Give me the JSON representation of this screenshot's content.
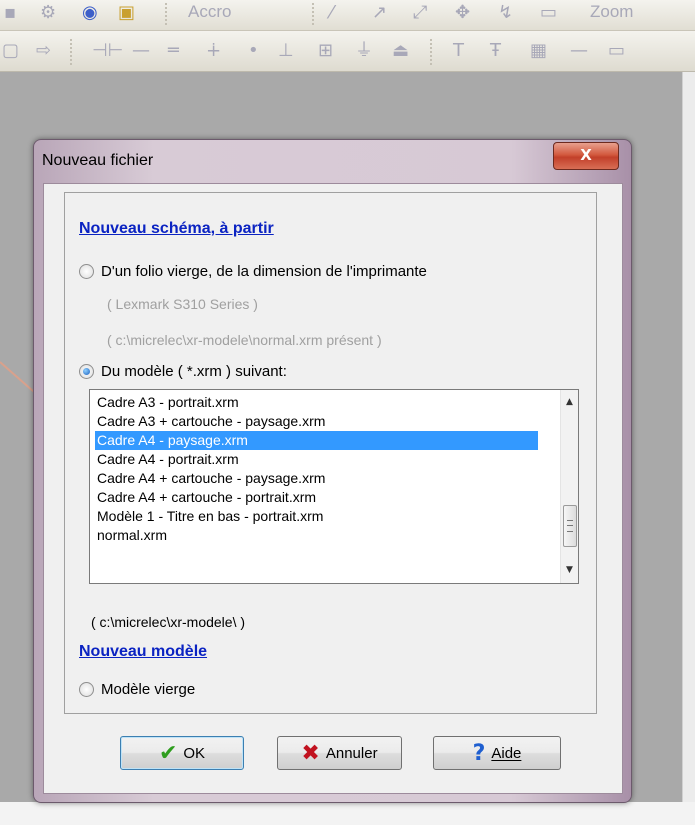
{
  "toolbar": {
    "accro_label": "Accro",
    "zoom_label": "Zoom"
  },
  "dialog": {
    "title": "Nouveau fichier",
    "close_label": "X",
    "section_schema": "Nouveau schéma, à partir",
    "option_folio": "D'un folio vierge, de la dimension de l'imprimante",
    "printer_name": "( Lexmark S310 Series )",
    "printer_path": "( c:\\micrelec\\xr-modele\\normal.xrm présent )",
    "option_modele": "Du modèle ( *.xrm ) suivant:",
    "templates": [
      "Cadre A3 - portrait.xrm",
      "Cadre A3 + cartouche - paysage.xrm",
      "Cadre A4 - paysage.xrm",
      "Cadre A4 - portrait.xrm",
      "Cadre A4 + cartouche - paysage.xrm",
      "Cadre A4 + cartouche - portrait.xrm",
      "Modèle 1 - Titre en bas - portrait.xrm",
      "normal.xrm"
    ],
    "selected_template": "Cadre A4 - paysage.xrm",
    "template_dir": "( c:\\micrelec\\xr-modele\\ )",
    "section_modele": "Nouveau modèle",
    "option_vierge": "Modèle vierge",
    "ok_label": "OK",
    "cancel_label": "Annuler",
    "help_label": "Aide"
  },
  "colors": {
    "heading": "#0b23c2",
    "selection": "#3399ff",
    "ok_check": "#2e9d1e",
    "cancel_x": "#c1121f",
    "help_q": "#1f5fd0"
  }
}
